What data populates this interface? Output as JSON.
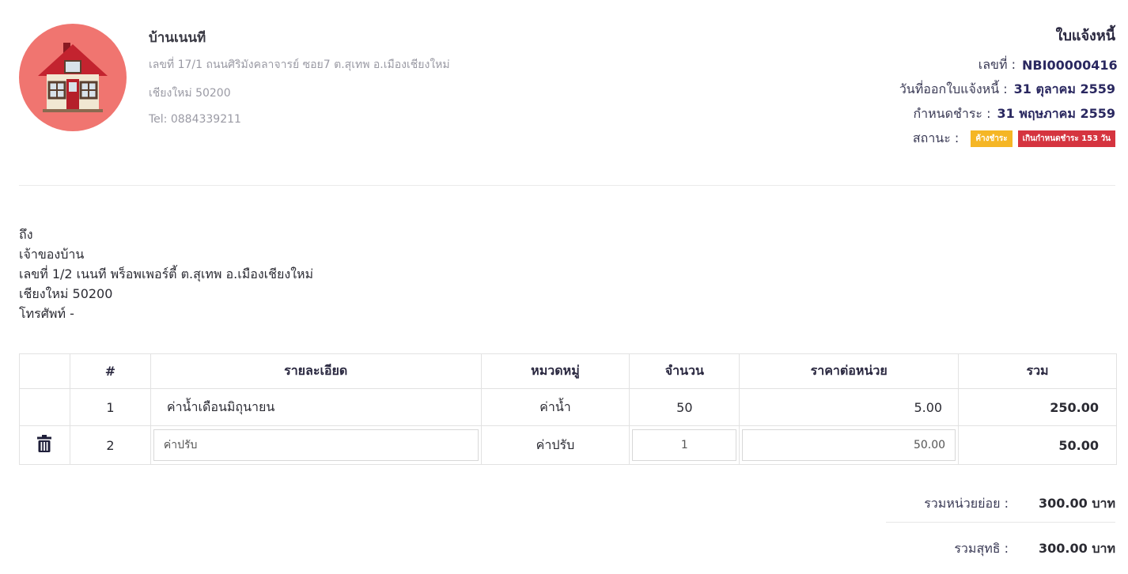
{
  "company": {
    "name": "บ้านเนนที",
    "address": "เลขที่ 17/1 ถนนศิริมังคลาจารย์ ซอย7 ต.สุเทพ อ.เมืองเชียงใหม่",
    "city": "เชียงใหม่ 50200",
    "tel": "Tel: 0884339211"
  },
  "invoice": {
    "title": "ใบแจ้งหนี้",
    "number_label": "เลขที่ :",
    "number": "NBI00000416",
    "issue_label": "วันที่ออกใบแจ้งหนี้ :",
    "issue_date": "31 ตุลาคม 2559",
    "due_label": "กำหนดชำระ :",
    "due_date": "31 พฤษภาคม 2559",
    "status_label": "สถานะ :",
    "status_badge": "ค้างชำระ",
    "overdue_badge": "เกินกำหนดชำระ 153 วัน"
  },
  "recipient": {
    "heading": "ถึง",
    "name": "เจ้าของบ้าน",
    "address": "เลขที่ 1/2 เนนที พร็อพเพอร์ตี้ ต.สุเทพ อ.เมืองเชียงใหม่",
    "city": "เชียงใหม่ 50200",
    "phone": "โทรศัพท์ -"
  },
  "table": {
    "headers": [
      "",
      "#",
      "รายละเอียด",
      "หมวดหมู่",
      "จำนวน",
      "ราคาต่อหน่วย",
      "รวม"
    ],
    "rows": [
      {
        "no": "1",
        "detail": "ค่าน้ำเดือนมิถุนายน",
        "category": "ค่าน้ำ",
        "qty": "50",
        "unit_price": "5.00",
        "total": "250.00"
      },
      {
        "no": "2",
        "detail": "ค่าปรับ",
        "category": "ค่าปรับ",
        "qty": "1",
        "unit_price": "50.00",
        "total": "50.00"
      }
    ]
  },
  "summary": {
    "subtotal_label": "รวมหน่วยย่อย :",
    "subtotal_value": "300.00 บาท",
    "net_label": "รวมสุทธิ :",
    "net_value": "300.00 บาท"
  },
  "icons": {
    "logo": "house-logo-icon",
    "delete": "trash-icon"
  },
  "colors": {
    "badge_pending": "#f5b625",
    "badge_overdue": "#d5343f",
    "logo_bg": "#f07570"
  }
}
